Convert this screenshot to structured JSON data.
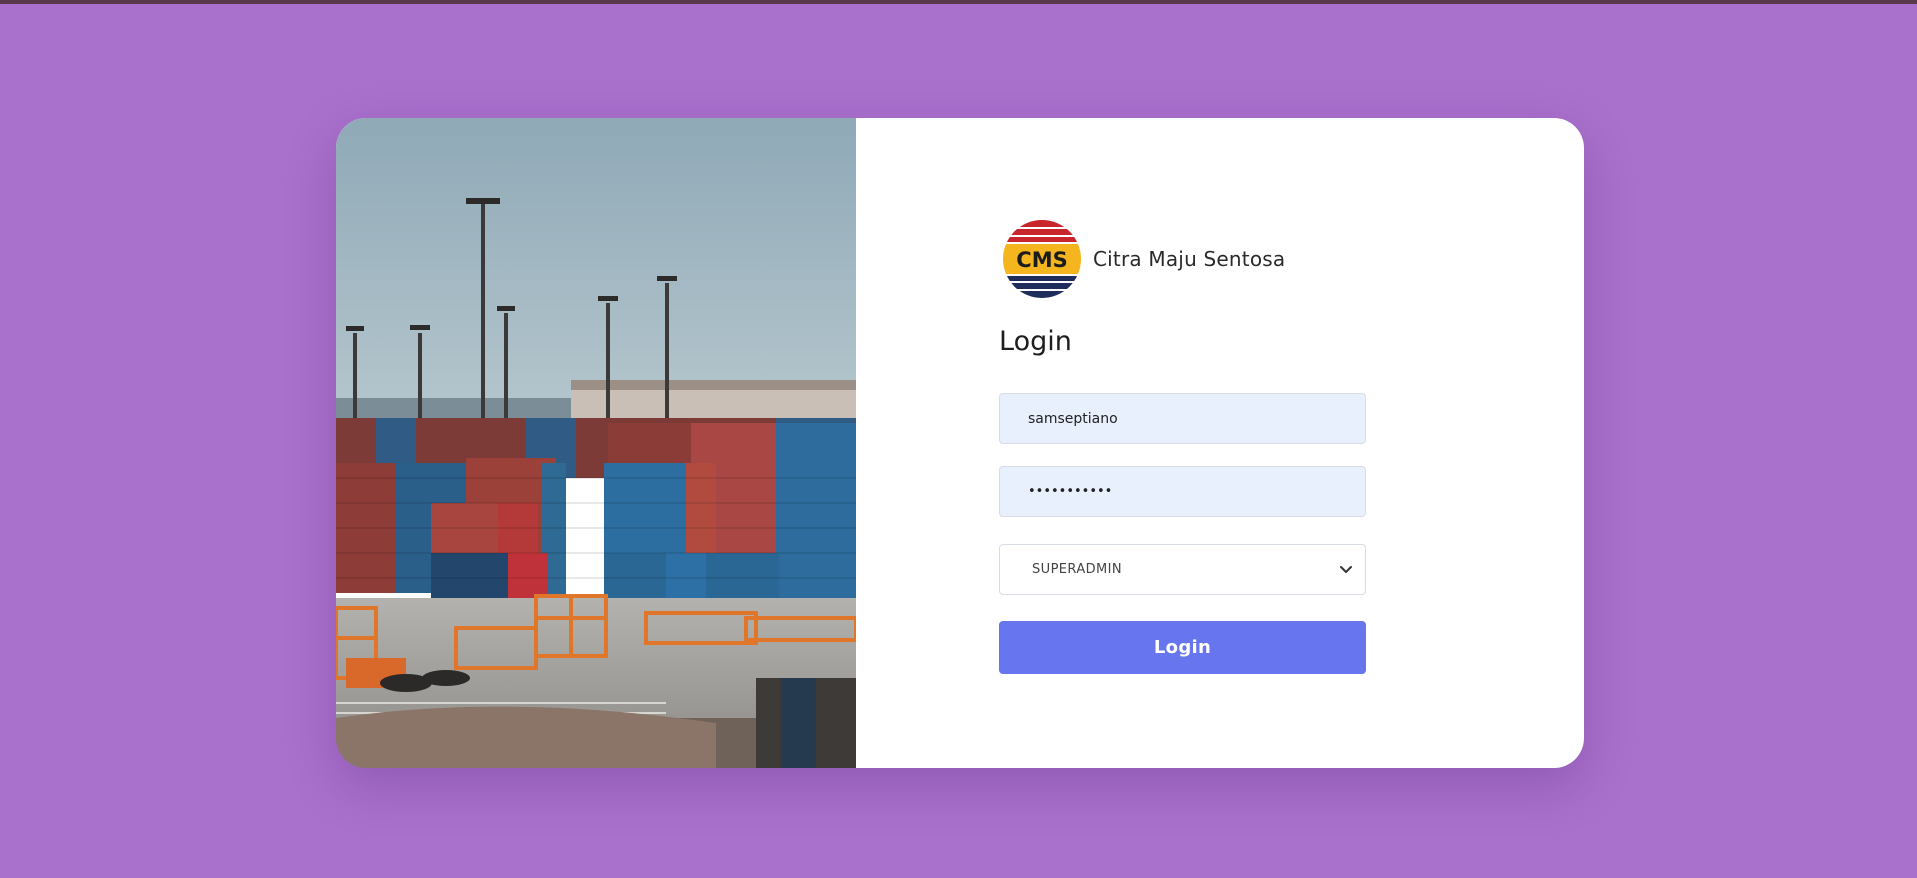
{
  "brand": {
    "logo_text": "CMS",
    "name": "Citra Maju Sentosa"
  },
  "form": {
    "title": "Login",
    "username_value": "samseptiano",
    "password_value": "•••••••••••",
    "role_selected": "SUPERADMIN",
    "submit_label": "Login"
  },
  "colors": {
    "page_background": "#a970cc",
    "card_background": "#ffffff",
    "input_autofill_background": "#e8f0fe",
    "button_primary": "#6776ee",
    "logo_red": "#c8252c",
    "logo_yellow": "#f5b51e",
    "logo_navy": "#1f2d5a"
  },
  "icons": {
    "select_indicator": "chevron-down-icon"
  }
}
